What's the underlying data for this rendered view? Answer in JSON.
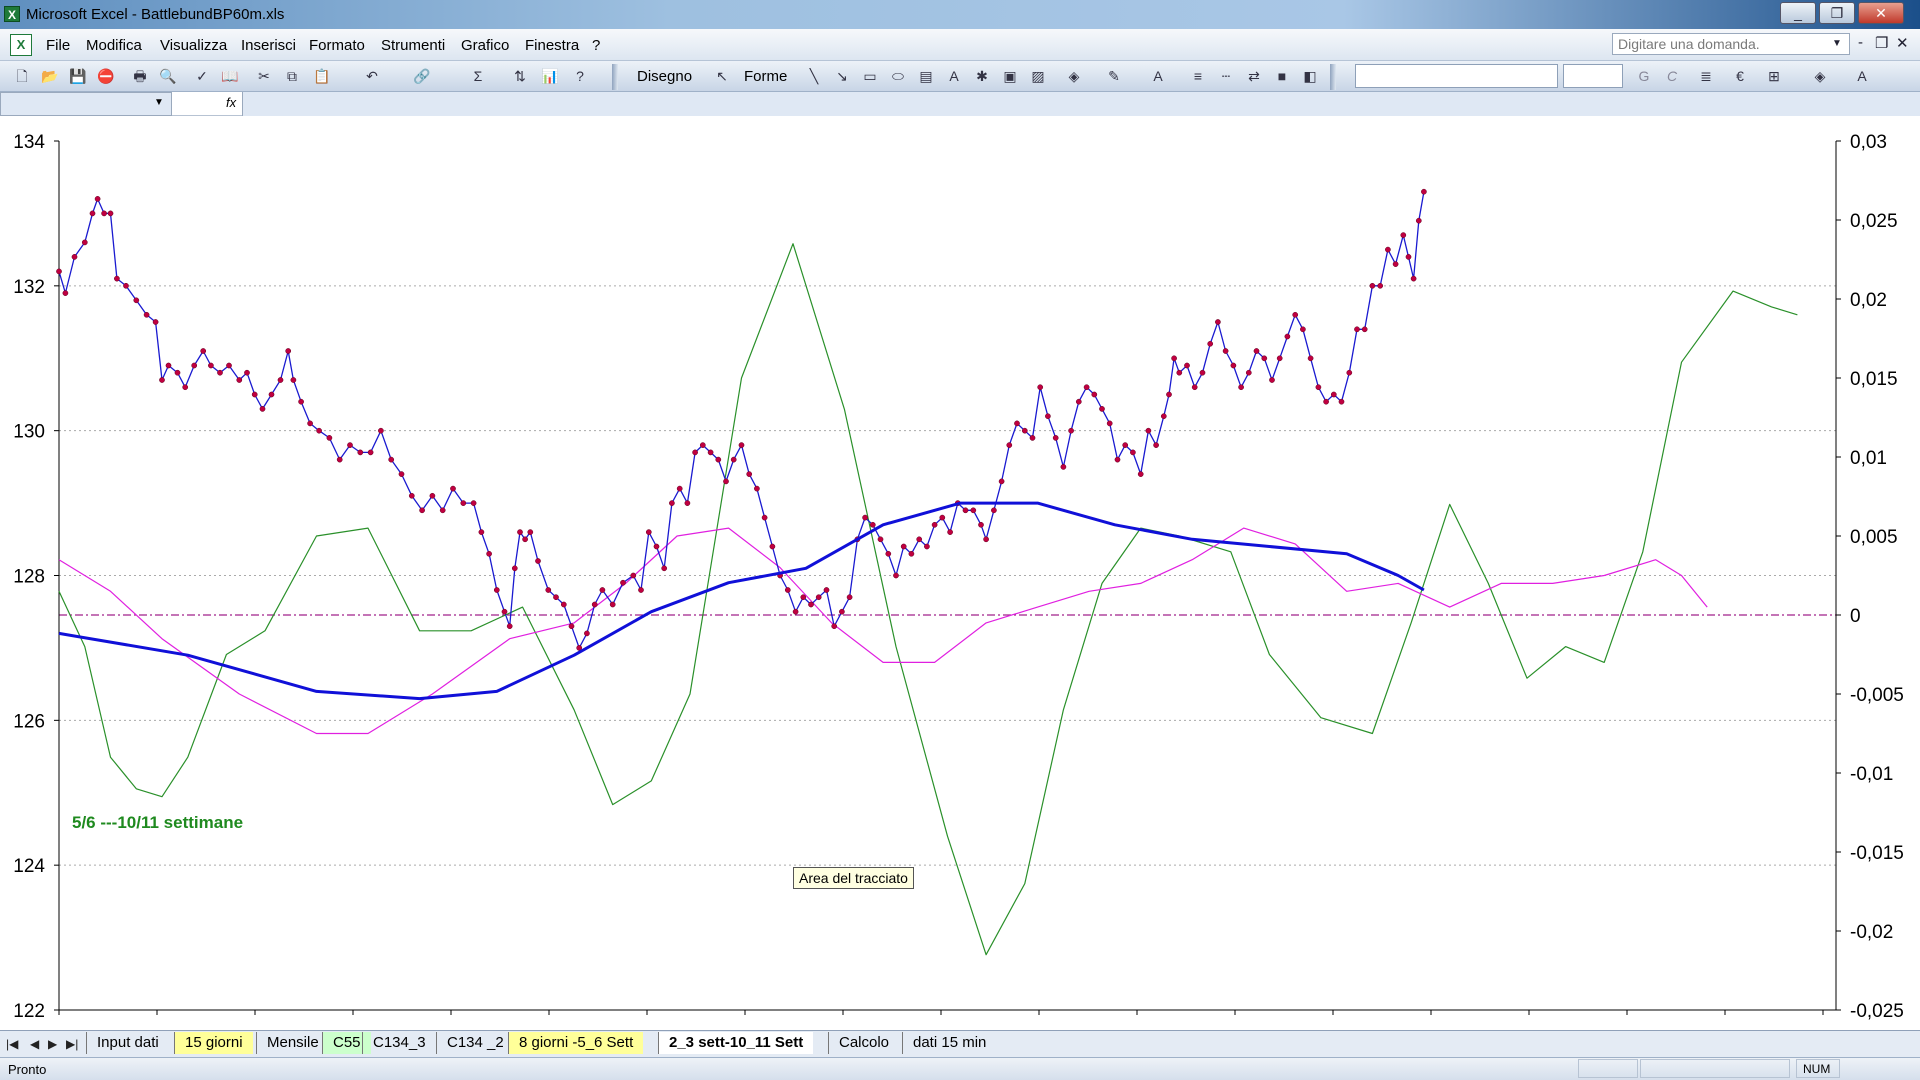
{
  "window": {
    "title": "Microsoft Excel - BattlebundBP60m.xls",
    "app_icon": "excel-icon",
    "controls": [
      "_",
      "❐",
      "✕"
    ]
  },
  "menu": {
    "items": [
      "File",
      "Modifica",
      "Visualizza",
      "Inserisci",
      "Formato",
      "Strumenti",
      "Grafico",
      "Finestra",
      "?"
    ],
    "ask_placeholder": "Digitare una domanda.",
    "mdi_controls": [
      "-",
      "❐",
      "✕"
    ]
  },
  "toolbar": {
    "draw_label": "Disegno",
    "shapes_label": "Forme",
    "bold_label": "G",
    "italic_label": "C",
    "euro_label": "€"
  },
  "chart_data": {
    "type": "line",
    "x_count": 380,
    "left_axis": {
      "ylim": [
        122,
        134
      ],
      "ticks": [
        "134",
        "132",
        "130",
        "128",
        "126",
        "124",
        "122"
      ]
    },
    "right_axis": {
      "ylim": [
        -0.025,
        0.03
      ],
      "ticks": [
        "0,03",
        "0,025",
        "0,02",
        "0,015",
        "0,01",
        "0,005",
        "0",
        "-0,005",
        "-0,01",
        "-0,015",
        "-0,02",
        "-0,025"
      ]
    },
    "grid": "horizontal-dotted",
    "zero_line_color": "#a0208a",
    "series": [
      {
        "axis": "left",
        "color": "#1a1ad0",
        "marker_color": "#c00040",
        "style": "price-with-markers",
        "points": [
          [
            0,
            132.2
          ],
          [
            5,
            131.9
          ],
          [
            12,
            132.4
          ],
          [
            20,
            132.6
          ],
          [
            26,
            133.0
          ],
          [
            30,
            133.2
          ],
          [
            35,
            133.0
          ],
          [
            40,
            133.0
          ],
          [
            45,
            132.1
          ],
          [
            52,
            132.0
          ],
          [
            60,
            131.8
          ],
          [
            68,
            131.6
          ],
          [
            75,
            131.5
          ],
          [
            80,
            130.7
          ],
          [
            85,
            130.9
          ],
          [
            92,
            130.8
          ],
          [
            98,
            130.6
          ],
          [
            105,
            130.9
          ],
          [
            112,
            131.1
          ],
          [
            118,
            130.9
          ],
          [
            125,
            130.8
          ],
          [
            132,
            130.9
          ],
          [
            140,
            130.7
          ],
          [
            146,
            130.8
          ],
          [
            152,
            130.5
          ],
          [
            158,
            130.3
          ],
          [
            165,
            130.5
          ],
          [
            172,
            130.7
          ],
          [
            178,
            131.1
          ],
          [
            182,
            130.7
          ],
          [
            188,
            130.4
          ],
          [
            195,
            130.1
          ],
          [
            202,
            130.0
          ],
          [
            210,
            129.9
          ],
          [
            218,
            129.6
          ],
          [
            226,
            129.8
          ],
          [
            234,
            129.7
          ],
          [
            242,
            129.7
          ],
          [
            250,
            130.0
          ],
          [
            258,
            129.6
          ],
          [
            266,
            129.4
          ],
          [
            274,
            129.1
          ],
          [
            282,
            128.9
          ],
          [
            290,
            129.1
          ],
          [
            298,
            128.9
          ],
          [
            306,
            129.2
          ],
          [
            314,
            129.0
          ],
          [
            322,
            129.0
          ],
          [
            328,
            128.6
          ],
          [
            334,
            128.3
          ],
          [
            340,
            127.8
          ],
          [
            346,
            127.5
          ],
          [
            350,
            127.3
          ],
          [
            354,
            128.1
          ],
          [
            358,
            128.6
          ],
          [
            362,
            128.5
          ],
          [
            366,
            128.6
          ],
          [
            372,
            128.2
          ],
          [
            380,
            127.8
          ],
          [
            386,
            127.7
          ],
          [
            392,
            127.6
          ],
          [
            398,
            127.3
          ],
          [
            404,
            127.0
          ],
          [
            410,
            127.2
          ],
          [
            416,
            127.6
          ],
          [
            422,
            127.8
          ],
          [
            430,
            127.6
          ],
          [
            438,
            127.9
          ],
          [
            446,
            128.0
          ],
          [
            452,
            127.8
          ],
          [
            458,
            128.6
          ],
          [
            464,
            128.4
          ],
          [
            470,
            128.1
          ],
          [
            476,
            129.0
          ],
          [
            482,
            129.2
          ],
          [
            488,
            129.0
          ],
          [
            494,
            129.7
          ],
          [
            500,
            129.8
          ],
          [
            506,
            129.7
          ],
          [
            512,
            129.6
          ],
          [
            518,
            129.3
          ],
          [
            524,
            129.6
          ],
          [
            530,
            129.8
          ],
          [
            536,
            129.4
          ],
          [
            542,
            129.2
          ],
          [
            548,
            128.8
          ],
          [
            554,
            128.4
          ],
          [
            560,
            128.0
          ],
          [
            566,
            127.8
          ],
          [
            572,
            127.5
          ],
          [
            578,
            127.7
          ],
          [
            584,
            127.6
          ],
          [
            590,
            127.7
          ],
          [
            596,
            127.8
          ],
          [
            602,
            127.3
          ],
          [
            608,
            127.5
          ],
          [
            614,
            127.7
          ],
          [
            620,
            128.5
          ],
          [
            626,
            128.8
          ],
          [
            632,
            128.7
          ],
          [
            638,
            128.5
          ],
          [
            644,
            128.3
          ],
          [
            650,
            128.0
          ],
          [
            656,
            128.4
          ],
          [
            662,
            128.3
          ],
          [
            668,
            128.5
          ],
          [
            674,
            128.4
          ],
          [
            680,
            128.7
          ],
          [
            686,
            128.8
          ],
          [
            692,
            128.6
          ],
          [
            698,
            129.0
          ],
          [
            704,
            128.9
          ],
          [
            710,
            128.9
          ],
          [
            716,
            128.7
          ],
          [
            720,
            128.5
          ],
          [
            726,
            128.9
          ],
          [
            732,
            129.3
          ],
          [
            738,
            129.8
          ],
          [
            744,
            130.1
          ],
          [
            750,
            130.0
          ],
          [
            756,
            129.9
          ],
          [
            762,
            130.6
          ],
          [
            768,
            130.2
          ],
          [
            774,
            129.9
          ],
          [
            780,
            129.5
          ],
          [
            786,
            130.0
          ],
          [
            792,
            130.4
          ],
          [
            798,
            130.6
          ],
          [
            804,
            130.5
          ],
          [
            810,
            130.3
          ],
          [
            816,
            130.1
          ],
          [
            822,
            129.6
          ],
          [
            828,
            129.8
          ],
          [
            834,
            129.7
          ],
          [
            840,
            129.4
          ],
          [
            846,
            130.0
          ],
          [
            852,
            129.8
          ],
          [
            858,
            130.2
          ],
          [
            862,
            130.5
          ],
          [
            866,
            131.0
          ],
          [
            870,
            130.8
          ],
          [
            876,
            130.9
          ],
          [
            882,
            130.6
          ],
          [
            888,
            130.8
          ],
          [
            894,
            131.2
          ],
          [
            900,
            131.5
          ],
          [
            906,
            131.1
          ],
          [
            912,
            130.9
          ],
          [
            918,
            130.6
          ],
          [
            924,
            130.8
          ],
          [
            930,
            131.1
          ],
          [
            936,
            131.0
          ],
          [
            942,
            130.7
          ],
          [
            948,
            131.0
          ],
          [
            954,
            131.3
          ],
          [
            960,
            131.6
          ],
          [
            966,
            131.4
          ],
          [
            972,
            131.0
          ],
          [
            978,
            130.6
          ],
          [
            984,
            130.4
          ],
          [
            990,
            130.5
          ],
          [
            996,
            130.4
          ],
          [
            1002,
            130.8
          ],
          [
            1008,
            131.4
          ],
          [
            1014,
            131.4
          ],
          [
            1020,
            132.0
          ],
          [
            1026,
            132.0
          ],
          [
            1032,
            132.5
          ],
          [
            1038,
            132.3
          ],
          [
            1044,
            132.7
          ],
          [
            1048,
            132.4
          ],
          [
            1052,
            132.1
          ],
          [
            1056,
            132.9
          ],
          [
            1060,
            133.3
          ]
        ]
      },
      {
        "axis": "left",
        "color": "#1010d8",
        "style": "thick-trend",
        "points": [
          [
            0,
            127.2
          ],
          [
            100,
            126.9
          ],
          [
            200,
            126.4
          ],
          [
            280,
            126.3
          ],
          [
            340,
            126.4
          ],
          [
            400,
            126.9
          ],
          [
            460,
            127.5
          ],
          [
            520,
            127.9
          ],
          [
            580,
            128.1
          ],
          [
            640,
            128.7
          ],
          [
            700,
            129.0
          ],
          [
            760,
            129.0
          ],
          [
            820,
            128.7
          ],
          [
            880,
            128.5
          ],
          [
            940,
            128.4
          ],
          [
            1000,
            128.3
          ],
          [
            1040,
            128.0
          ],
          [
            1060,
            127.8
          ]
        ]
      },
      {
        "axis": "right",
        "color": "#e020e0",
        "style": "thin",
        "points": [
          [
            0,
            0.0035
          ],
          [
            40,
            0.0015
          ],
          [
            80,
            -0.0015
          ],
          [
            140,
            -0.005
          ],
          [
            200,
            -0.0075
          ],
          [
            240,
            -0.0075
          ],
          [
            290,
            -0.005
          ],
          [
            350,
            -0.0015
          ],
          [
            400,
            -0.0005
          ],
          [
            440,
            0.002
          ],
          [
            480,
            0.005
          ],
          [
            520,
            0.0055
          ],
          [
            560,
            0.003
          ],
          [
            600,
            -0.0005
          ],
          [
            640,
            -0.003
          ],
          [
            680,
            -0.003
          ],
          [
            720,
            -0.0005
          ],
          [
            760,
            0.0005
          ],
          [
            800,
            0.0015
          ],
          [
            840,
            0.002
          ],
          [
            880,
            0.0035
          ],
          [
            920,
            0.0055
          ],
          [
            960,
            0.0045
          ],
          [
            1000,
            0.0015
          ],
          [
            1040,
            0.002
          ],
          [
            1080,
            0.0005
          ],
          [
            1120,
            0.002
          ],
          [
            1160,
            0.002
          ],
          [
            1200,
            0.0025
          ],
          [
            1240,
            0.0035
          ],
          [
            1260,
            0.0025
          ],
          [
            1280,
            0.0005
          ]
        ]
      },
      {
        "axis": "right",
        "color": "#2a902a",
        "style": "thin",
        "points": [
          [
            0,
            0.0015
          ],
          [
            20,
            -0.002
          ],
          [
            40,
            -0.009
          ],
          [
            60,
            -0.011
          ],
          [
            80,
            -0.0115
          ],
          [
            100,
            -0.009
          ],
          [
            130,
            -0.0025
          ],
          [
            160,
            -0.001
          ],
          [
            200,
            0.005
          ],
          [
            240,
            0.0055
          ],
          [
            280,
            -0.001
          ],
          [
            320,
            -0.001
          ],
          [
            360,
            0.0005
          ],
          [
            400,
            -0.006
          ],
          [
            430,
            -0.012
          ],
          [
            460,
            -0.0105
          ],
          [
            490,
            -0.005
          ],
          [
            530,
            0.015
          ],
          [
            570,
            0.0235
          ],
          [
            610,
            0.013
          ],
          [
            650,
            -0.002
          ],
          [
            690,
            -0.014
          ],
          [
            720,
            -0.0215
          ],
          [
            750,
            -0.017
          ],
          [
            780,
            -0.006
          ],
          [
            810,
            0.002
          ],
          [
            840,
            0.0055
          ],
          [
            870,
            0.005
          ],
          [
            910,
            0.004
          ],
          [
            940,
            -0.0025
          ],
          [
            980,
            -0.0065
          ],
          [
            1020,
            -0.0075
          ],
          [
            1050,
            -0.0005
          ],
          [
            1080,
            0.007
          ],
          [
            1110,
            0.002
          ],
          [
            1140,
            -0.004
          ],
          [
            1170,
            -0.002
          ],
          [
            1200,
            -0.003
          ],
          [
            1230,
            0.004
          ],
          [
            1260,
            0.016
          ],
          [
            1300,
            0.0205
          ],
          [
            1330,
            0.0195
          ],
          [
            1350,
            0.019
          ]
        ]
      }
    ],
    "x_plot_span": 1380
  },
  "chart_text": {
    "note": "5/6 ---10/11 settimane",
    "tooltip": "Area del tracciato"
  },
  "sheets": {
    "nav": [
      "|◀",
      "◀",
      "▶",
      "▶|"
    ],
    "tabs": [
      {
        "label": "Input dati",
        "color": "none"
      },
      {
        "label": "15 giorni",
        "color": "yellow"
      },
      {
        "label": "Mensile",
        "color": "none"
      },
      {
        "label": "C55",
        "color": "green"
      },
      {
        "label": "C134_3",
        "color": "none"
      },
      {
        "label": "C134 _2",
        "color": "none"
      },
      {
        "label": "8 giorni -5_6 Sett",
        "color": "yellow"
      },
      {
        "label": "2_3 sett-10_11 Sett",
        "color": "active"
      },
      {
        "label": "Calcolo",
        "color": "none"
      },
      {
        "label": "dati 15 min",
        "color": "none"
      }
    ]
  },
  "status": {
    "text": "Pronto",
    "num": "NUM"
  }
}
